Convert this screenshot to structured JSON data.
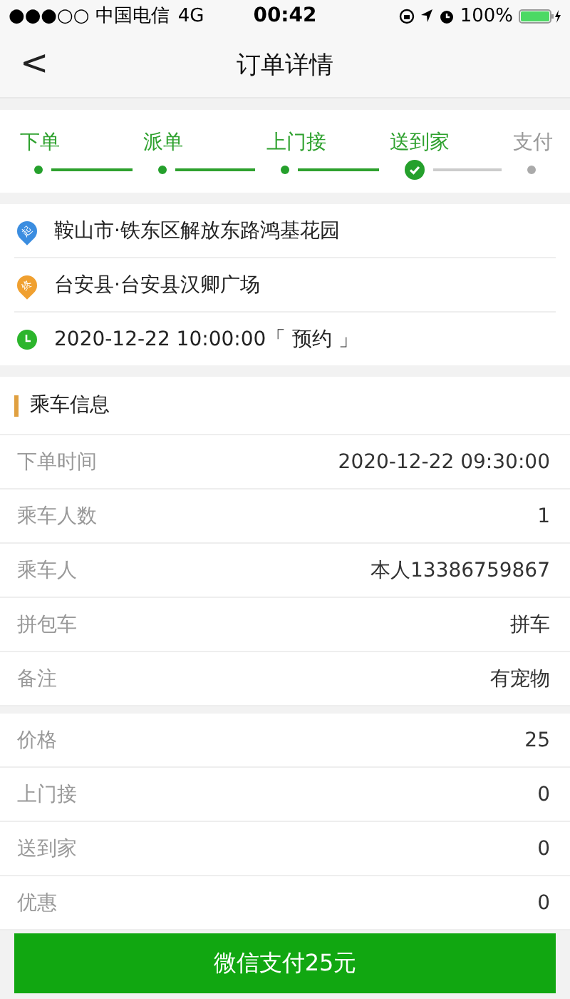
{
  "status_bar": {
    "carrier": "●●●○○ 中国电信",
    "network": "4G",
    "time": "00:42",
    "battery": "100%"
  },
  "nav": {
    "back": "<",
    "title": "订单详情"
  },
  "steps": [
    {
      "label": "下单",
      "done": true,
      "current": false
    },
    {
      "label": "派单",
      "done": true,
      "current": false
    },
    {
      "label": "上门接",
      "done": true,
      "current": false
    },
    {
      "label": "送到家",
      "done": true,
      "current": true
    },
    {
      "label": "支付",
      "done": false,
      "current": false
    }
  ],
  "route": [
    {
      "kind": "start",
      "badge": "起",
      "text": "鞍山市·铁东区解放东路鸿基花园"
    },
    {
      "kind": "end",
      "badge": "终",
      "text": "台安县·台安县汉卿广场"
    },
    {
      "kind": "time",
      "text": "2020-12-22 10:00:00「 预约 」"
    }
  ],
  "info": {
    "title": "乘车信息",
    "groups": [
      [
        {
          "label": "下单时间",
          "value": "2020-12-22 09:30:00"
        },
        {
          "label": "乘车人数",
          "value": "1"
        },
        {
          "label": "乘车人",
          "value": "本人13386759867"
        },
        {
          "label": "拼包车",
          "value": "拼车"
        },
        {
          "label": "备注",
          "value": "有宠物"
        }
      ],
      [
        {
          "label": "价格",
          "value": "25"
        },
        {
          "label": "上门接",
          "value": "0"
        },
        {
          "label": "送到家",
          "value": "0"
        },
        {
          "label": "优惠",
          "value": "0"
        }
      ]
    ]
  },
  "pay_button": "微信支付25元"
}
